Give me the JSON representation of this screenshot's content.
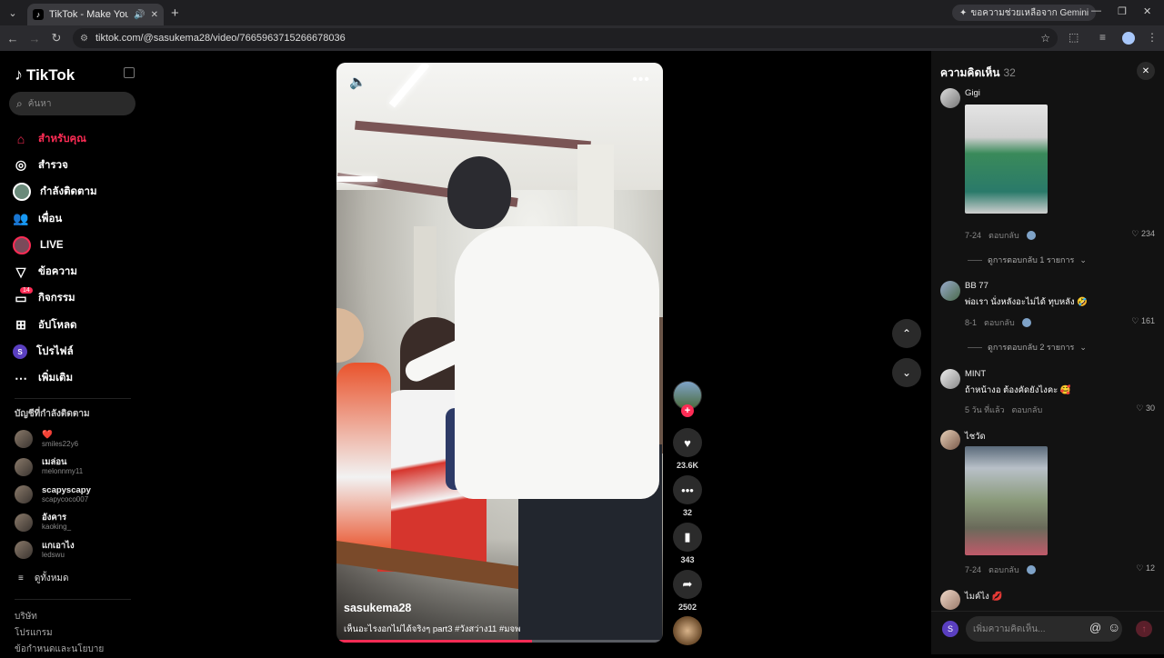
{
  "browser": {
    "tab_title": "TikTok - Make Your Day",
    "url": "tiktok.com/@sasukema28/video/7665963715266678036",
    "gemini_label": "ขอความช่วยเหลือจาก Gemini"
  },
  "sidebar": {
    "logo_text": "TikTok",
    "search_placeholder": "ค้นหา",
    "nav": [
      {
        "label": "สำหรับคุณ",
        "icon": "home-icon"
      },
      {
        "label": "สำรวจ",
        "icon": "compass-icon"
      },
      {
        "label": "กำลังติดตาม",
        "icon": "following-icon"
      },
      {
        "label": "เพื่อน",
        "icon": "friends-icon"
      },
      {
        "label": "LIVE",
        "icon": "live-icon"
      },
      {
        "label": "ข้อความ",
        "icon": "message-icon"
      },
      {
        "label": "กิจกรรม",
        "icon": "activity-icon",
        "badge": "14"
      },
      {
        "label": "อัปโหลด",
        "icon": "upload-icon"
      },
      {
        "label": "โปรไฟล์",
        "icon": "profile-icon"
      },
      {
        "label": "เพิ่มเติม",
        "icon": "more-icon"
      }
    ],
    "following_title": "บัญชีที่กำลังติดตาม",
    "following": [
      {
        "name": "❤️",
        "handle": "smiles22y6"
      },
      {
        "name": "เมล่อน",
        "handle": "melonnmy11"
      },
      {
        "name": "scapyscapy",
        "handle": "scapycoco007"
      },
      {
        "name": "อังคาร",
        "handle": "kaoking_"
      },
      {
        "name": "แกเอาไง",
        "handle": "ledswu"
      }
    ],
    "see_all": "ดูทั้งหมด",
    "footer": [
      "บริษัท",
      "โปรแกรม",
      "ข้อกำหนดและนโยบาย"
    ]
  },
  "video": {
    "username": "sasukema28",
    "caption": "เห็นอะไรงอกไม่ได้จริงๆ part3 #วังสว่าง11 #มจพ",
    "progress": 0.6
  },
  "actions": {
    "likes": "23.6K",
    "comments": "32",
    "saves": "343",
    "shares": "2502"
  },
  "comments_panel": {
    "title": "ความคิดเห็น",
    "count": "32",
    "input_placeholder": "เพิ่มความคิดเห็น...",
    "reply_label": "ตอบกลับ",
    "items": [
      {
        "name": "Gigi",
        "text": "",
        "date": "7-24",
        "likes": "234",
        "replies": "ดูการตอบกลับ 1 รายการ"
      },
      {
        "name": "BB 77",
        "text": "พ่อเรา นั่งหลังอะไม่ได้ ทุบหลัง 🤣",
        "date": "8-1",
        "likes": "161",
        "replies": "ดูการตอบกลับ 2 รายการ"
      },
      {
        "name": "MINT",
        "text": "ถ้าหน้างอ ต้องคัดยังไงคะ 🥰",
        "date": "5 วัน ที่แล้ว",
        "likes": "30"
      },
      {
        "name": "ไชวัด",
        "text": "",
        "date": "7-24",
        "likes": "12"
      },
      {
        "name": "ไมค์ไง 💋",
        "text": ""
      }
    ]
  }
}
